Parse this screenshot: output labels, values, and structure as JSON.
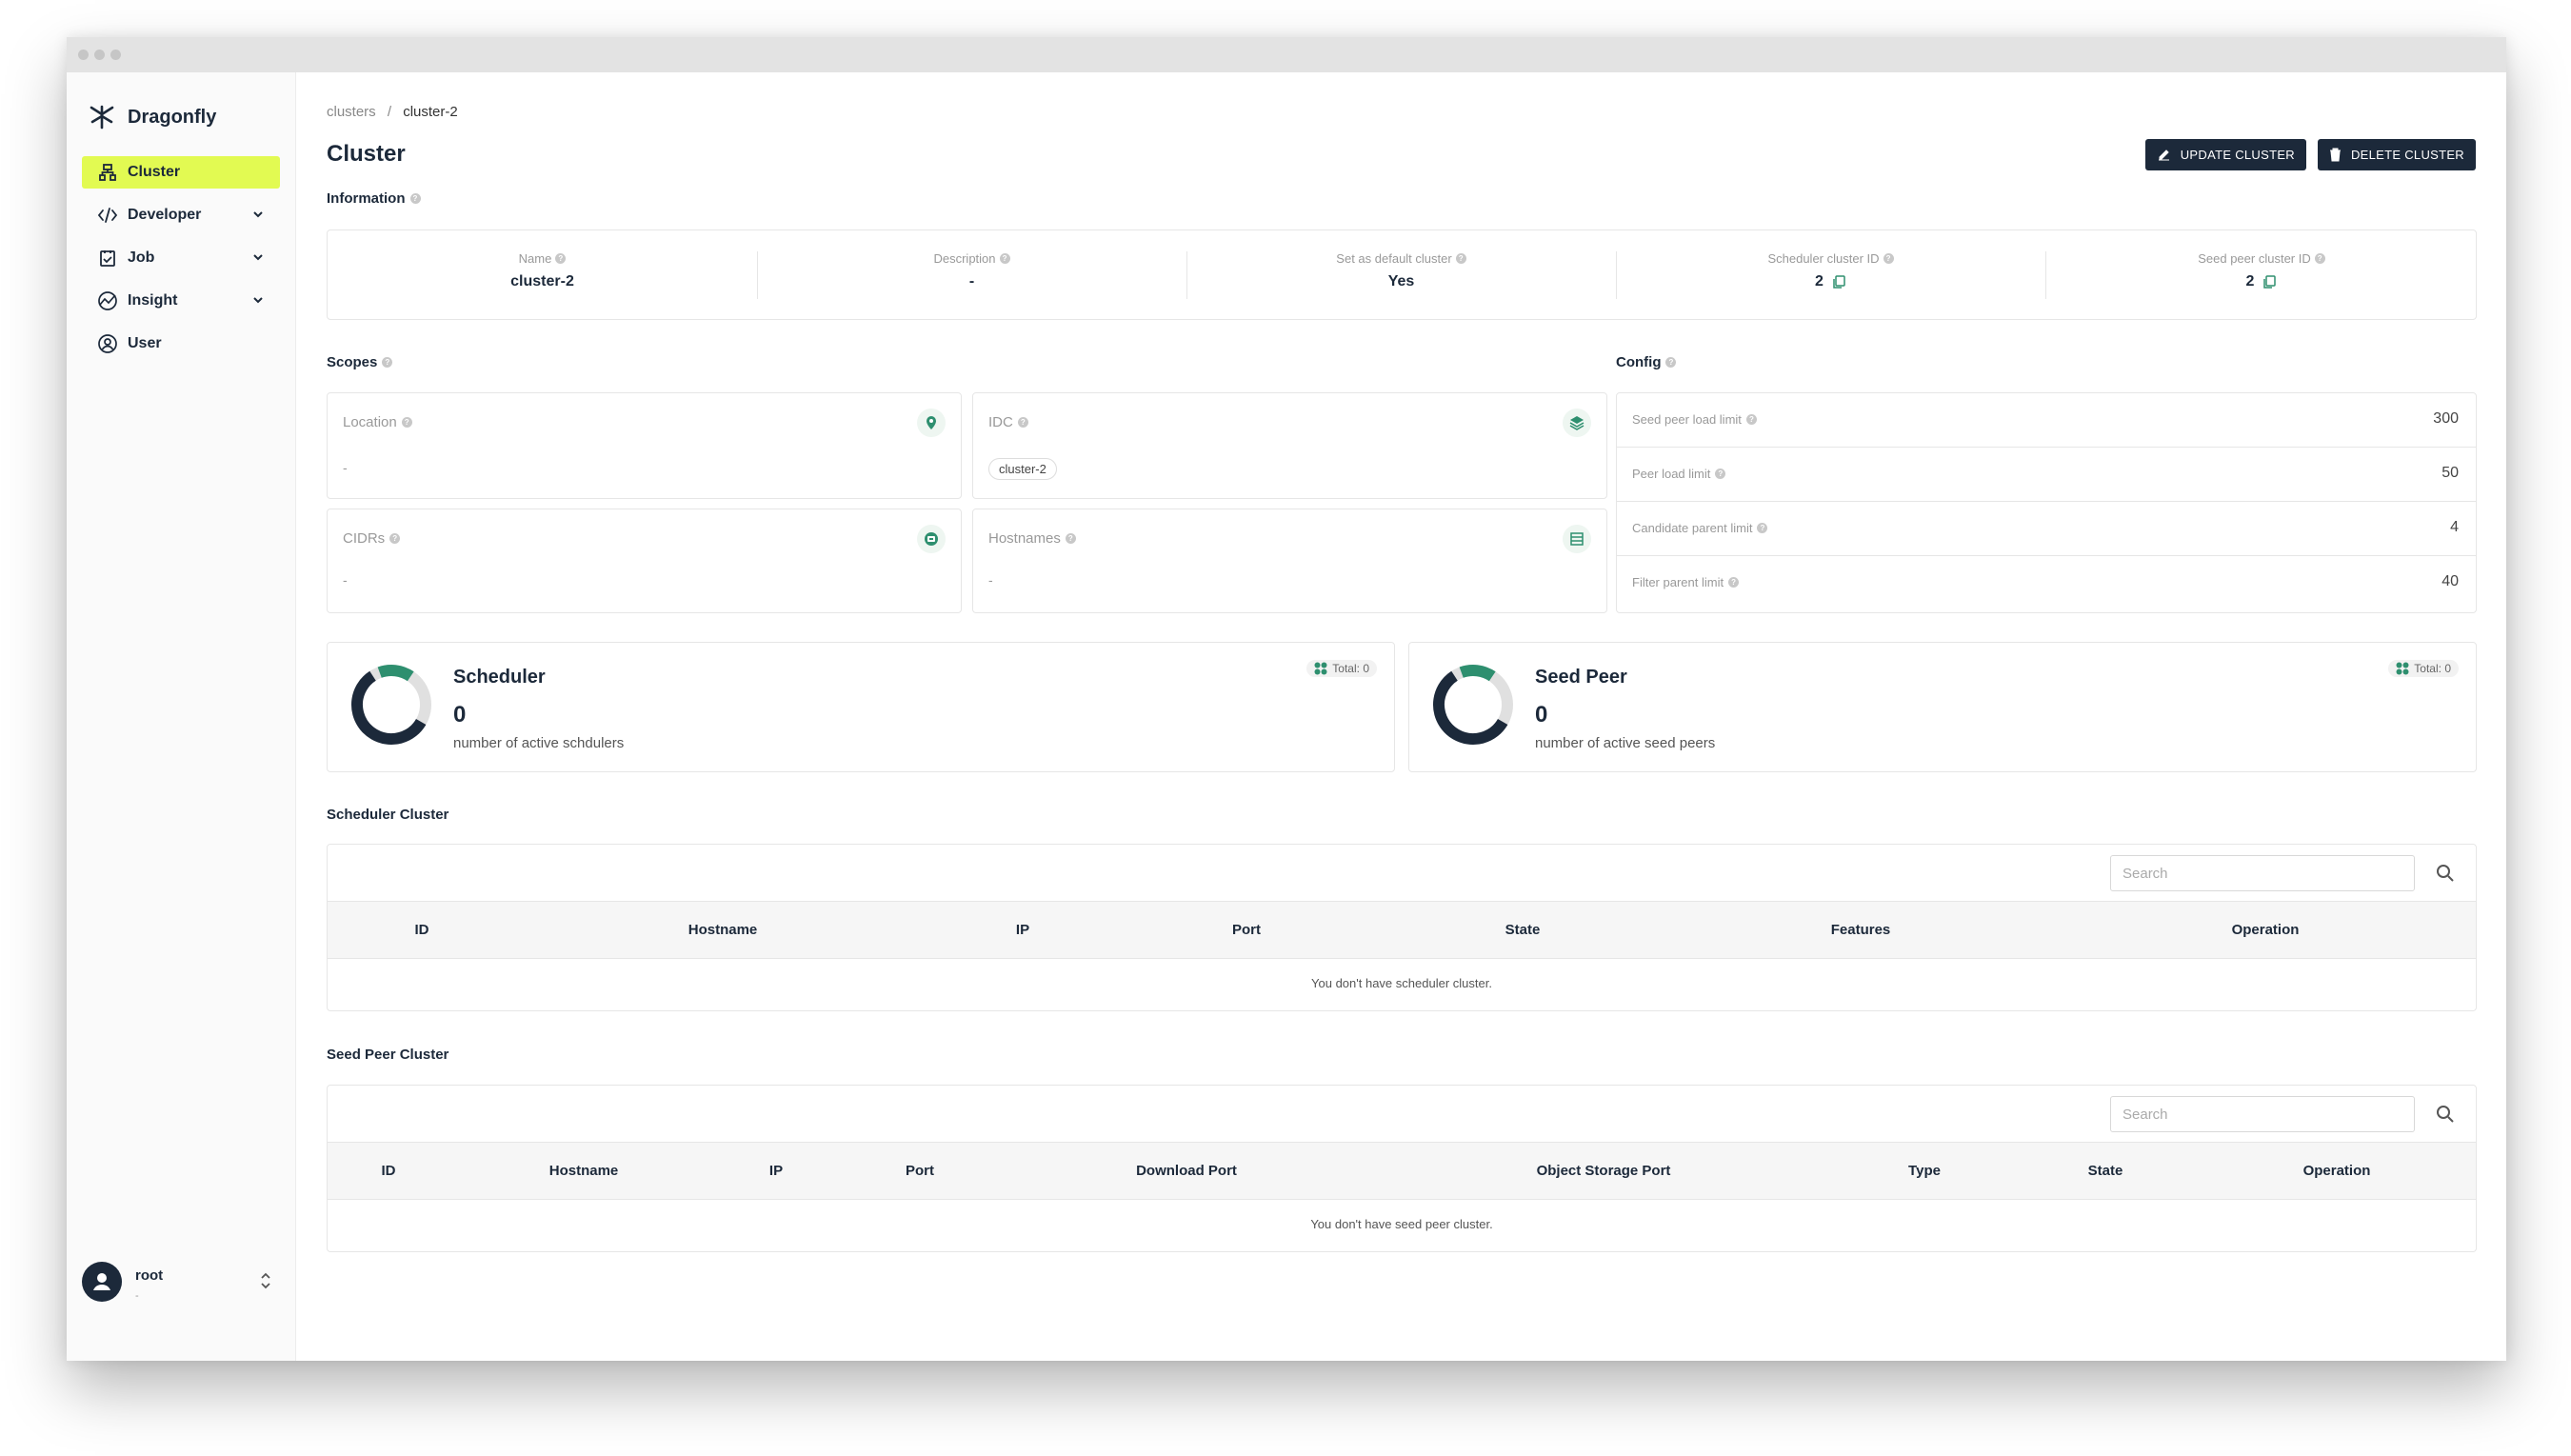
{
  "app": {
    "name": "Dragonfly"
  },
  "sidebar": {
    "items": [
      {
        "label": "Cluster",
        "icon": "cluster-icon",
        "active": true
      },
      {
        "label": "Developer",
        "icon": "code-icon",
        "expandable": true
      },
      {
        "label": "Job",
        "icon": "job-icon",
        "expandable": true
      },
      {
        "label": "Insight",
        "icon": "insight-icon",
        "expandable": true
      },
      {
        "label": "User",
        "icon": "user-icon"
      }
    ],
    "user": {
      "name": "root",
      "sub": "-"
    }
  },
  "breadcrumb": {
    "parent": "clusters",
    "separator": "/",
    "current": "cluster-2"
  },
  "page": {
    "title": "Cluster"
  },
  "actions": {
    "update": "UPDATE CLUSTER",
    "delete": "DELETE CLUSTER"
  },
  "information": {
    "title": "Information",
    "fields": [
      {
        "label": "Name",
        "value": "cluster-2"
      },
      {
        "label": "Description",
        "value": "-"
      },
      {
        "label": "Set as default cluster",
        "value": "Yes"
      },
      {
        "label": "Scheduler cluster ID",
        "value": "2"
      },
      {
        "label": "Seed peer cluster ID",
        "value": "2"
      }
    ]
  },
  "scopes": {
    "title": "Scopes",
    "location": {
      "label": "Location",
      "value": "-",
      "icon": "location-icon"
    },
    "idc": {
      "label": "IDC",
      "value": "cluster-2",
      "icon": "layers-icon"
    },
    "cidrs": {
      "label": "CIDRs",
      "value": "-",
      "icon": "network-icon"
    },
    "hostnames": {
      "label": "Hostnames",
      "value": "-",
      "icon": "storage-icon"
    }
  },
  "config": {
    "title": "Config",
    "rows": [
      {
        "label": "Seed peer load limit",
        "value": "300"
      },
      {
        "label": "Peer load limit",
        "value": "50"
      },
      {
        "label": "Candidate parent limit",
        "value": "4"
      },
      {
        "label": "Filter parent limit",
        "value": "40"
      }
    ]
  },
  "stats": {
    "scheduler": {
      "title": "Scheduler",
      "count": "0",
      "desc": "number of active schdulers",
      "total": "Total: 0"
    },
    "seed_peer": {
      "title": "Seed Peer",
      "count": "0",
      "desc": "number of active seed peers",
      "total": "Total: 0"
    }
  },
  "scheduler_cluster": {
    "title": "Scheduler Cluster",
    "search_placeholder": "Search",
    "columns": [
      "ID",
      "Hostname",
      "IP",
      "Port",
      "State",
      "Features",
      "Operation"
    ],
    "empty": "You don't have scheduler cluster."
  },
  "seed_peer_cluster": {
    "title": "Seed Peer Cluster",
    "search_placeholder": "Search",
    "columns": [
      "ID",
      "Hostname",
      "IP",
      "Port",
      "Download Port",
      "Object Storage Port",
      "Type",
      "State",
      "Operation"
    ],
    "empty": "You don't have seed peer cluster."
  },
  "colors": {
    "accent": "#e2fa52",
    "dark": "#1c293a",
    "green": "#2e8f6f"
  }
}
